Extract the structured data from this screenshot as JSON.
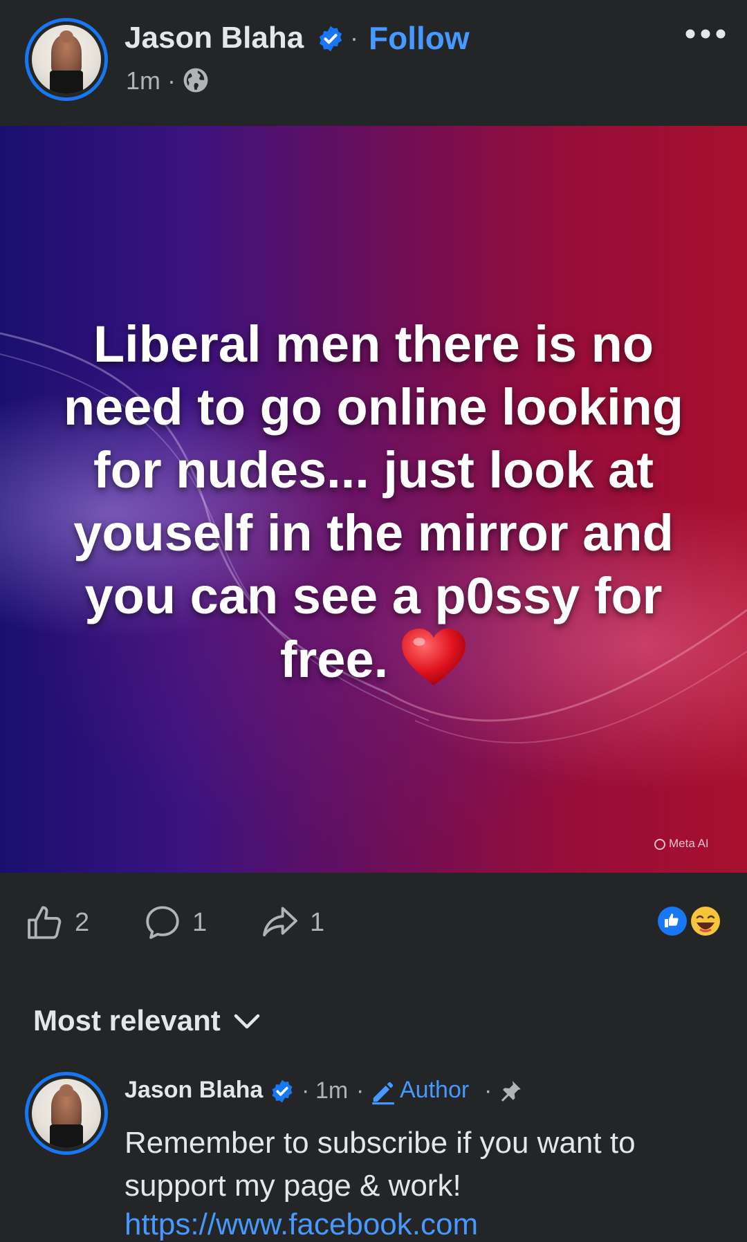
{
  "post": {
    "author": "Jason Blaha",
    "follow_label": "Follow",
    "time": "1m",
    "separator": "·",
    "image_text": "Liberal men there is no\nneed to go online looking\nfor nudes... just look at\nyouself in the mirror and\nyou can see a p0ssy for\nfree.",
    "watermark": "Meta AI"
  },
  "actions": {
    "likes": "2",
    "comments": "1",
    "shares": "1"
  },
  "comments": {
    "sort_label": "Most relevant",
    "first": {
      "author": "Jason Blaha",
      "time": "1m",
      "badge": "Author",
      "text": "Remember to subscribe if you want to support my page & work!",
      "link": "https://www.facebook.com"
    }
  },
  "icons": [
    "verified-badge-icon",
    "globe-icon",
    "more-icon",
    "heart-emoji-icon",
    "like-icon",
    "comment-icon",
    "share-icon",
    "like-reaction-icon",
    "haha-reaction-icon",
    "chevron-down-icon",
    "pencil-icon",
    "pin-icon"
  ],
  "colors": {
    "background": "#242526",
    "accent": "#1877f2",
    "link": "#4599ff",
    "muted": "#b0b3b8"
  }
}
